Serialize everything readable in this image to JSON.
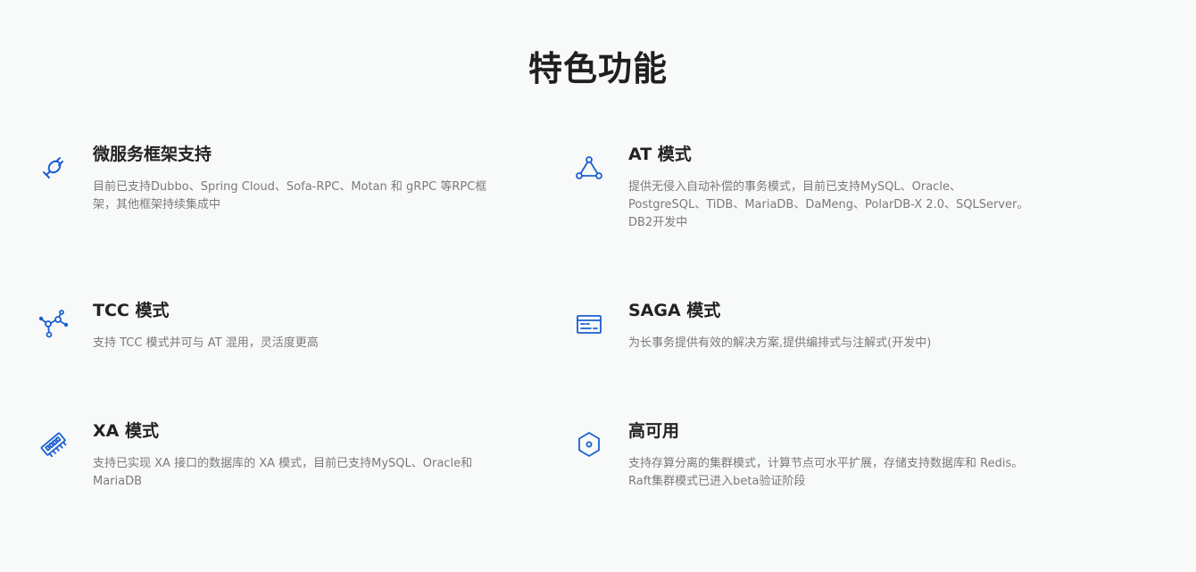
{
  "page": {
    "title": "特色功能"
  },
  "features": [
    {
      "title": "微服务框架支持",
      "description": "目前已支持Dubbo、Spring Cloud、Sofa-RPC、Motan 和 gRPC 等RPC框架，其他框架持续集成中",
      "icon": "plug-icon"
    },
    {
      "title": "AT 模式",
      "description": "提供无侵入自动补偿的事务模式，目前已支持MySQL、Oracle、PostgreSQL、TiDB、MariaDB、DaMeng、PolarDB-X 2.0、SQLServer。DB2开发中",
      "icon": "triangle-nodes-icon"
    },
    {
      "title": "TCC 模式",
      "description": "支持 TCC 模式并可与 AT 混用，灵活度更高",
      "icon": "network-nodes-icon"
    },
    {
      "title": "SAGA 模式",
      "description": "为长事务提供有效的解决方案,提供编排式与注解式(开发中)",
      "icon": "terminal-window-icon"
    },
    {
      "title": "XA 模式",
      "description": "支持已实现 XA 接口的数据库的 XA 模式，目前已支持MySQL、Oracle和MariaDB",
      "icon": "memory-chip-icon"
    },
    {
      "title": "高可用",
      "description": "支持存算分离的集群模式，计算节点可水平扩展，存储支持数据库和 Redis。Raft集群模式已进入beta验证阶段",
      "icon": "hexagon-icon"
    }
  ],
  "colors": {
    "background": "#f8fafa",
    "icon": "#1a5fd3",
    "title": "#222222",
    "description": "#7a7a7a"
  }
}
